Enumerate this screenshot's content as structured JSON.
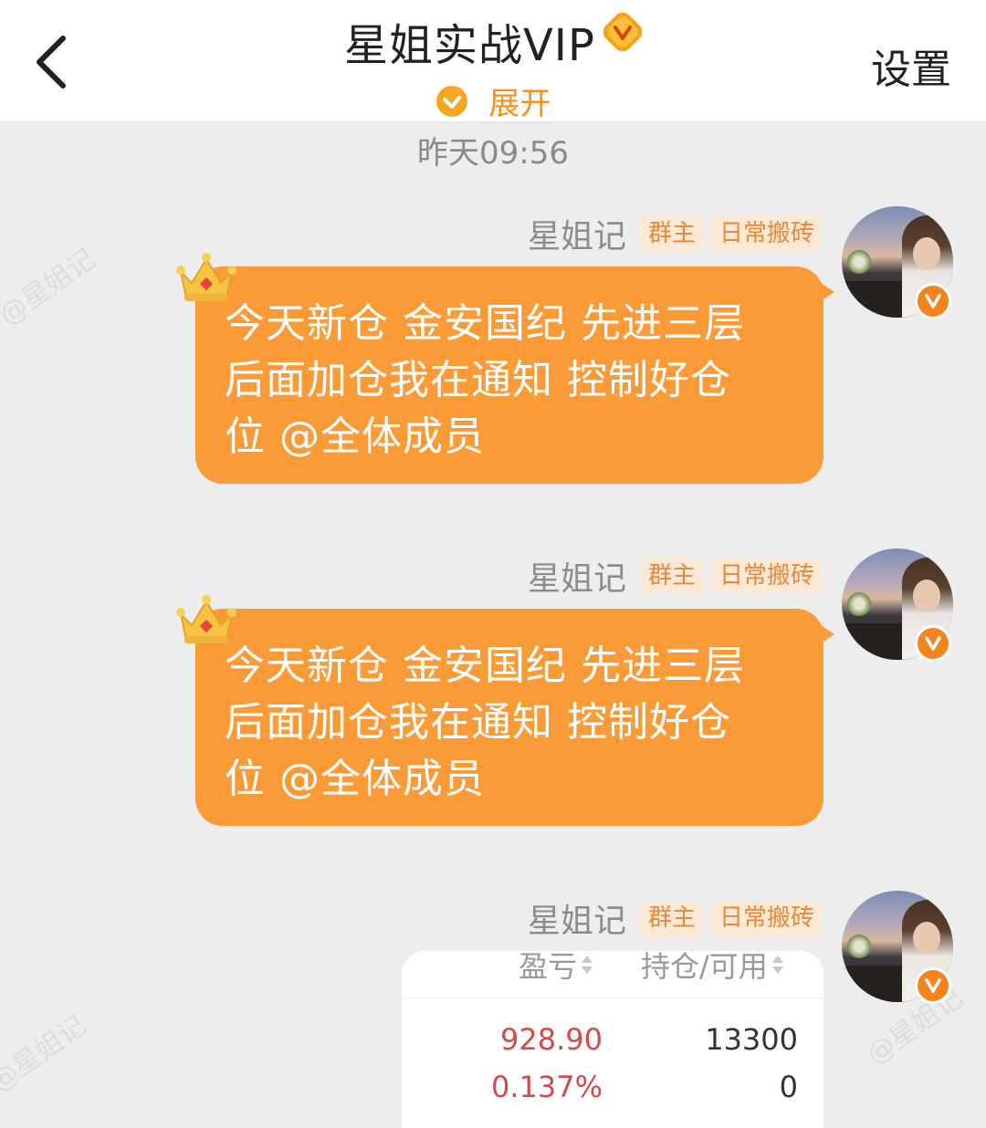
{
  "header": {
    "back_icon": "chevron-left-icon",
    "title": "星姐实战VIP",
    "vip_badge_icon": "vip-v-badge-icon",
    "expand_label": "展开",
    "settings_label": "设置"
  },
  "timestamp": "昨天09:56",
  "watermark": "@星姐记",
  "messages": [
    {
      "sender": "星姐记",
      "tags": [
        "群主",
        "日常搬砖"
      ],
      "text_lines": [
        "今天新仓 金安国纪 先进三层",
        "后面加仓我在通知 控制好仓",
        "位 @全体成员"
      ]
    },
    {
      "sender": "星姐记",
      "tags": [
        "群主",
        "日常搬砖"
      ],
      "text_lines": [
        "今天新仓 金安国纪 先进三层",
        "后面加仓我在通知 控制好仓",
        "位 @全体成员"
      ]
    },
    {
      "sender": "星姐记",
      "tags": [
        "群主",
        "日常搬砖"
      ],
      "card": {
        "col1_header": "盈亏",
        "col2_header": "持仓/可用",
        "pnl_value": "928.90",
        "pnl_percent": "0.137%",
        "position": "13300",
        "available": "0"
      }
    }
  ],
  "colors": {
    "bubble": "#fb9b37",
    "accent": "#f5901e",
    "profit_red": "#d24a4a"
  }
}
